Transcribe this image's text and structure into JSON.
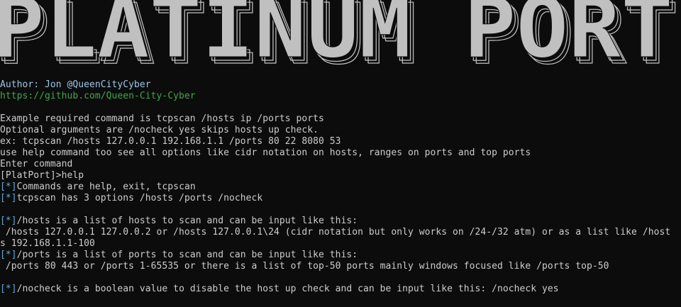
{
  "banner": {
    "title": "PLATINUM PORT"
  },
  "header": {
    "author": "Author: Jon @QueenCityCyber",
    "url": "https://github.com/Queen-City-Cyber"
  },
  "intro": {
    "line1": "Example required command is tcpscan /hosts ip /ports ports",
    "line2": "Optional arguments are /nocheck yes skips hosts up check.",
    "line3": "ex: tcpscan /hosts 127.0.0.1 192.168.1.1 /ports 80 22 8080 53",
    "line4": "use help command too see all options like cidr notation on hosts, ranges on ports and top ports",
    "line5": "Enter command"
  },
  "session": {
    "prompt": "[PlatPort]>",
    "command": "help"
  },
  "output": {
    "marker": "[*]",
    "commands": "Commands are help, exit, tcpscan",
    "tcpscan": "tcpscan has 3 options /hosts /ports /nocheck",
    "hosts_intro": "/hosts is a list of hosts to scan and can be input like this:",
    "hosts_example": " /hosts 127.0.0.1 127.0.0.2 or /hosts 127.0.0.1\\24 (cidr notation but only works on /24-/32 atm) or as a list like /host",
    "hosts_example_cont": "s 192.168.1.1-100",
    "ports_intro": "/ports is a list of ports to scan and can be input like this:",
    "ports_example": " /ports 80 443 or /ports 1-65535 or there is a list of top-50 ports mainly windows focused like /ports top-50",
    "nocheck": "/nocheck is a boolean value to disable the host up check and can be input like this: /nocheck yes"
  },
  "colors": {
    "background": "#0c0c0c",
    "text": "#cccccc",
    "author": "#9bc8e6",
    "link": "#3fa64a",
    "marker": "#5aa9d8",
    "banner_fill": "#c0c0c0"
  }
}
